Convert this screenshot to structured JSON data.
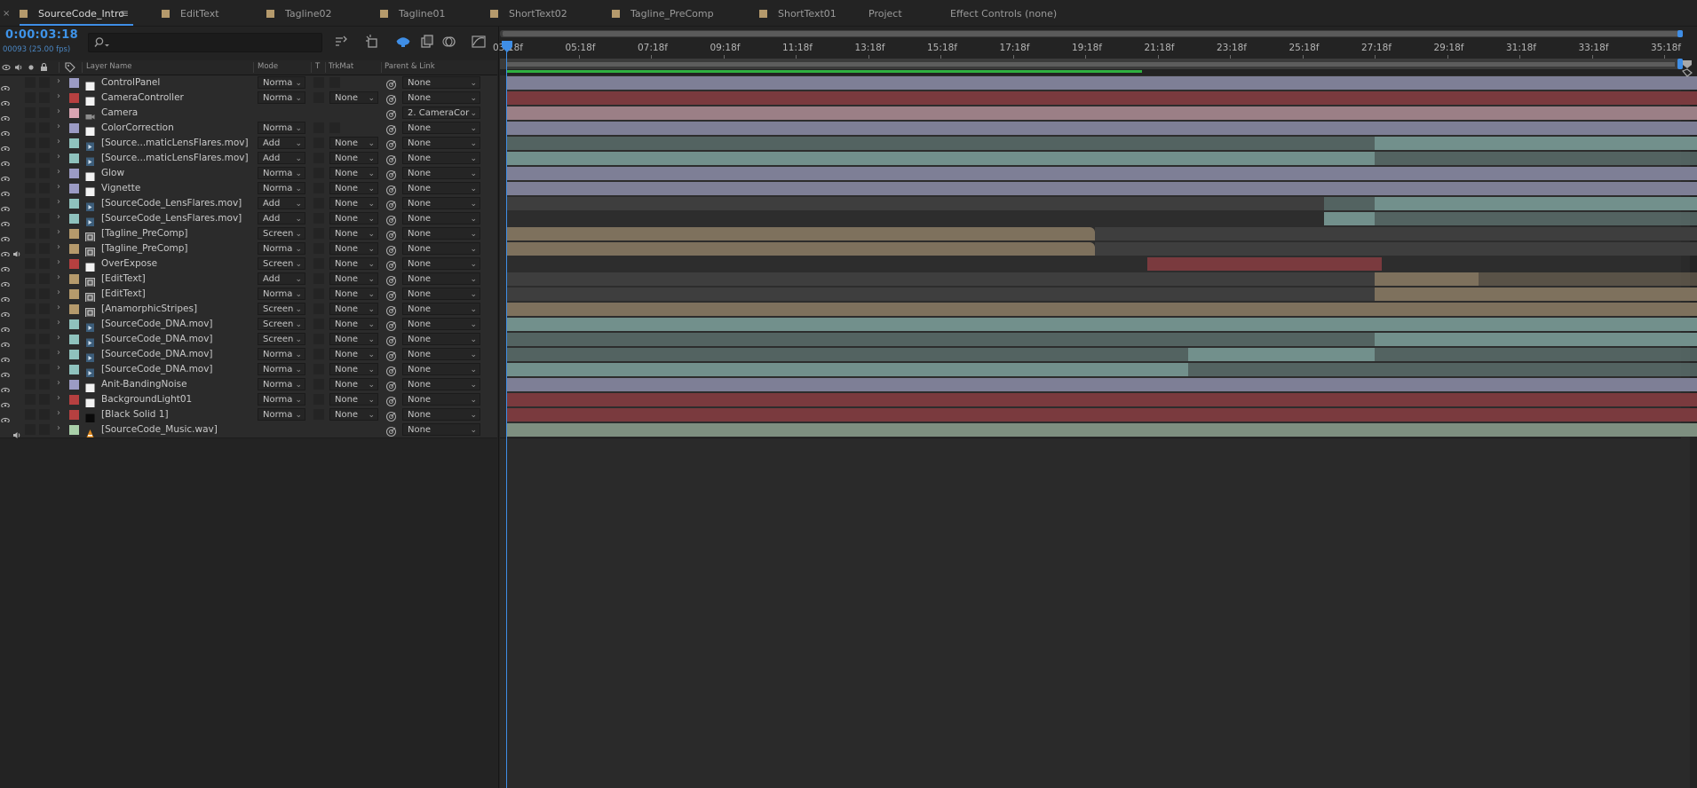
{
  "tabs": [
    {
      "label": "SourceCode_Intro",
      "color": "#b59a6c",
      "active": true
    },
    {
      "label": "EditText",
      "color": "#b59a6c"
    },
    {
      "label": "Tagline02",
      "color": "#b59a6c"
    },
    {
      "label": "Tagline01",
      "color": "#b59a6c"
    },
    {
      "label": "ShortText02",
      "color": "#b59a6c"
    },
    {
      "label": "Tagline_PreComp",
      "color": "#b59a6c"
    },
    {
      "label": "ShortText01",
      "color": "#b59a6c"
    },
    {
      "label": "Project",
      "color": null
    },
    {
      "label": "Effect Controls (none)",
      "color": null
    }
  ],
  "tab_close": "×",
  "tab_menu": "≡",
  "timecode": "0:00:03:18",
  "frame_info": "00093 (25.00 fps)",
  "search": {
    "placeholder": ""
  },
  "columns": {
    "layer_name": "Layer Name",
    "mode": "Mode",
    "t": "T",
    "trkmat": "TrkMat",
    "parent": "Parent & Link"
  },
  "layers": [
    {
      "name": "ControlPanel",
      "color": "#9b9bc4",
      "type": "solid",
      "mode": "Norma",
      "trkmat": null,
      "parent": "None",
      "video": true,
      "audio": false
    },
    {
      "name": "CameraController",
      "color": "#b64040",
      "type": "solid",
      "mode": "Norma",
      "trkmat": "None",
      "parent": "None",
      "video": true,
      "audio": false
    },
    {
      "name": "Camera",
      "color": "#d9a5b2",
      "type": "camera",
      "mode": null,
      "trkmat": null,
      "parent": "2. CameraCor",
      "video": true,
      "audio": false
    },
    {
      "name": "ColorCorrection",
      "color": "#9b9bc4",
      "type": "solid",
      "mode": "Norma",
      "trkmat": null,
      "parent": "None",
      "video": true,
      "audio": false
    },
    {
      "name": "[Source...maticLensFlares.mov]",
      "color": "#8fc2bd",
      "type": "footage",
      "mode": "Add",
      "trkmat": "None",
      "parent": "None",
      "video": true,
      "audio": false
    },
    {
      "name": "[Source...maticLensFlares.mov]",
      "color": "#8fc2bd",
      "type": "footage",
      "mode": "Add",
      "trkmat": "None",
      "parent": "None",
      "video": true,
      "audio": false
    },
    {
      "name": "Glow",
      "color": "#9b9bc4",
      "type": "solid",
      "mode": "Norma",
      "trkmat": "None",
      "parent": "None",
      "video": true,
      "audio": false
    },
    {
      "name": "Vignette",
      "color": "#9b9bc4",
      "type": "solid",
      "mode": "Norma",
      "trkmat": "None",
      "parent": "None",
      "video": true,
      "audio": false
    },
    {
      "name": "[SourceCode_LensFlares.mov]",
      "color": "#8fc2bd",
      "type": "footage",
      "mode": "Add",
      "trkmat": "None",
      "parent": "None",
      "video": true,
      "audio": false
    },
    {
      "name": "[SourceCode_LensFlares.mov]",
      "color": "#8fc2bd",
      "type": "footage",
      "mode": "Add",
      "trkmat": "None",
      "parent": "None",
      "video": true,
      "audio": false
    },
    {
      "name": "[Tagline_PreComp]",
      "color": "#b59a6c",
      "type": "comp",
      "mode": "Screen",
      "trkmat": "None",
      "parent": "None",
      "video": true,
      "audio": false
    },
    {
      "name": "[Tagline_PreComp]",
      "color": "#b59a6c",
      "type": "comp",
      "mode": "Norma",
      "trkmat": "None",
      "parent": "None",
      "video": true,
      "audio": true
    },
    {
      "name": "OverExpose",
      "color": "#b64040",
      "type": "solid",
      "mode": "Screen",
      "trkmat": "None",
      "parent": "None",
      "video": true,
      "audio": false
    },
    {
      "name": "[EditText]",
      "color": "#b59a6c",
      "type": "comp",
      "mode": "Add",
      "trkmat": "None",
      "parent": "None",
      "video": true,
      "audio": false
    },
    {
      "name": "[EditText]",
      "color": "#b59a6c",
      "type": "comp",
      "mode": "Norma",
      "trkmat": "None",
      "parent": "None",
      "video": true,
      "audio": false
    },
    {
      "name": "[AnamorphicStripes]",
      "color": "#b59a6c",
      "type": "comp",
      "mode": "Screen",
      "trkmat": "None",
      "parent": "None",
      "video": true,
      "audio": false
    },
    {
      "name": "[SourceCode_DNA.mov]",
      "color": "#8fc2bd",
      "type": "footage",
      "mode": "Screen",
      "trkmat": "None",
      "parent": "None",
      "video": true,
      "audio": false
    },
    {
      "name": "[SourceCode_DNA.mov]",
      "color": "#8fc2bd",
      "type": "footage",
      "mode": "Screen",
      "trkmat": "None",
      "parent": "None",
      "video": true,
      "audio": false
    },
    {
      "name": "[SourceCode_DNA.mov]",
      "color": "#8fc2bd",
      "type": "footage",
      "mode": "Norma",
      "trkmat": "None",
      "parent": "None",
      "video": true,
      "audio": false
    },
    {
      "name": "[SourceCode_DNA.mov]",
      "color": "#8fc2bd",
      "type": "footage",
      "mode": "Norma",
      "trkmat": "None",
      "parent": "None",
      "video": true,
      "audio": false
    },
    {
      "name": "Anit-BandingNoise",
      "color": "#9b9bc4",
      "type": "solid",
      "mode": "Norma",
      "trkmat": "None",
      "parent": "None",
      "video": true,
      "audio": false
    },
    {
      "name": "BackgroundLight01",
      "color": "#b64040",
      "type": "solid",
      "mode": "Norma",
      "trkmat": "None",
      "parent": "None",
      "video": true,
      "audio": false
    },
    {
      "name": "[Black Solid 1]",
      "color": "#b64040",
      "type": "blacksolid",
      "mode": "Norma",
      "trkmat": "None",
      "parent": "None",
      "video": true,
      "audio": false
    },
    {
      "name": "[SourceCode_Music.wav]",
      "color": "#a9d0a9",
      "type": "audio",
      "mode": null,
      "trkmat": null,
      "parent": "None",
      "video": false,
      "audio": true
    }
  ],
  "ruler_ticks": [
    "03:18f",
    "05:18f",
    "07:18f",
    "09:18f",
    "11:18f",
    "13:18f",
    "15:18f",
    "17:18f",
    "19:18f",
    "21:18f",
    "23:18f",
    "25:18f",
    "27:18f",
    "29:18f",
    "31:18f",
    "33:18f",
    "35:18f"
  ],
  "track_colors": {
    "lavender": "#7e7f96",
    "red": "#7a3a3e",
    "pink": "#9b7f86",
    "teal": "#72908c",
    "tan": "#7e715d",
    "sage": "#7e8f80",
    "inactive": "#3e3e3e"
  },
  "tracks": [
    [
      [
        "03:18f",
        "36:17f",
        "lavender"
      ]
    ],
    [
      [
        "03:18f",
        "36:17f",
        "red"
      ]
    ],
    [
      [
        "03:18f",
        "36:17f",
        "pink"
      ]
    ],
    [
      [
        "03:18f",
        "36:17f",
        "lavender"
      ]
    ],
    [
      [
        "03:18f",
        "27:18f",
        "teal",
        "dim"
      ],
      [
        "27:18f",
        "36:17f",
        "teal"
      ]
    ],
    [
      [
        "03:18f",
        "27:18f",
        "teal"
      ],
      [
        "27:18f",
        "36:17f",
        "teal",
        "dim"
      ]
    ],
    [
      [
        "03:18f",
        "36:17f",
        "lavender"
      ]
    ],
    [
      [
        "03:18f",
        "36:17f",
        "lavender"
      ]
    ],
    [
      [
        "03:18f",
        "26:08f",
        "inactive"
      ],
      [
        "26:08f",
        "27:18f",
        "teal",
        "dim"
      ],
      [
        "27:18f",
        "36:17f",
        "teal"
      ]
    ],
    [
      [
        "26:08f",
        "27:18f",
        "teal"
      ],
      [
        "27:18f",
        "36:17f",
        "teal",
        "dim"
      ]
    ],
    [
      [
        "03:18f",
        "20:00f",
        "tan",
        "cut"
      ],
      [
        "20:00f",
        "36:17f",
        "inactive"
      ]
    ],
    [
      [
        "03:18f",
        "20:00f",
        "tan",
        "cut"
      ],
      [
        "20:00f",
        "36:17f",
        "inactive"
      ]
    ],
    [
      [
        "21:11f",
        "27:23f",
        "red"
      ]
    ],
    [
      [
        "03:18f",
        "27:18f",
        "inactive"
      ],
      [
        "27:18f",
        "30:15f",
        "tan"
      ],
      [
        "30:15f",
        "36:17f",
        "tan",
        "dim"
      ]
    ],
    [
      [
        "03:18f",
        "27:18f",
        "inactive"
      ],
      [
        "27:18f",
        "36:17f",
        "tan"
      ]
    ],
    [
      [
        "03:18f",
        "36:17f",
        "tan"
      ]
    ],
    [
      [
        "03:18f",
        "36:17f",
        "teal"
      ]
    ],
    [
      [
        "03:18f",
        "27:18f",
        "teal",
        "dim"
      ],
      [
        "27:18f",
        "36:17f",
        "teal"
      ]
    ],
    [
      [
        "03:18f",
        "22:14f",
        "teal",
        "dim"
      ],
      [
        "22:14f",
        "27:18f",
        "teal"
      ],
      [
        "27:18f",
        "36:17f",
        "teal",
        "dim"
      ]
    ],
    [
      [
        "03:18f",
        "22:14f",
        "teal"
      ],
      [
        "22:14f",
        "36:17f",
        "teal",
        "dim"
      ]
    ],
    [
      [
        "03:18f",
        "36:17f",
        "lavender"
      ]
    ],
    [
      [
        "03:18f",
        "36:17f",
        "red"
      ]
    ],
    [
      [
        "03:18f",
        "36:17f",
        "red"
      ]
    ],
    [
      [
        "03:18f",
        "36:17f",
        "sage"
      ]
    ]
  ]
}
